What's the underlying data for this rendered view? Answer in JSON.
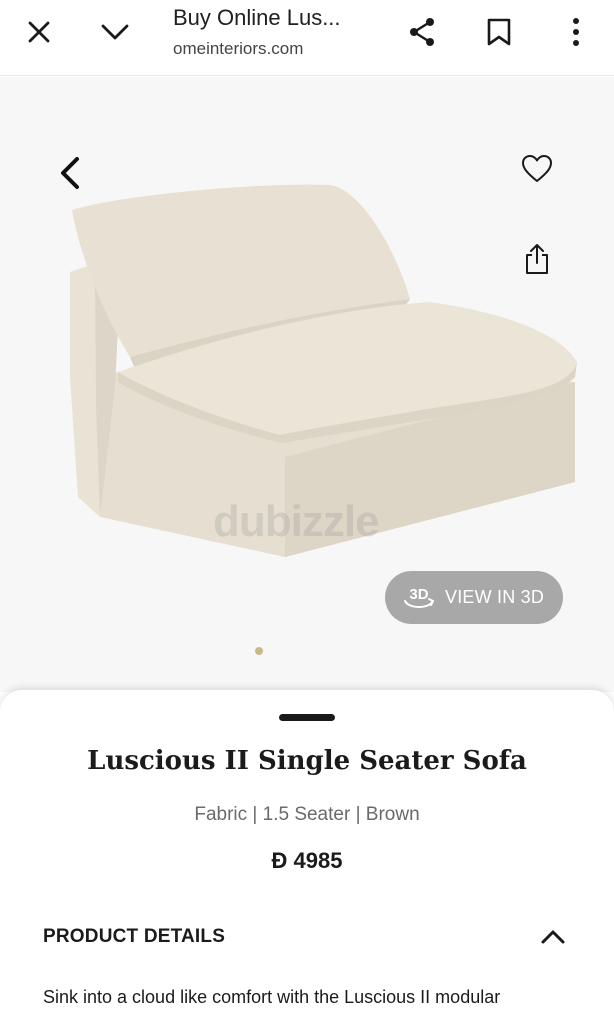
{
  "browser": {
    "title": "Buy Online Lus...",
    "url": "omeinteriors.com",
    "icons": {
      "close": "close-icon",
      "dropdown": "chevron-down-icon",
      "share": "share-icon",
      "bookmark": "bookmark-icon",
      "more": "more-vert-icon"
    }
  },
  "gallery": {
    "watermark": "dubizzle",
    "view3d_badge": "3D",
    "view3d_label": "VIEW IN 3D",
    "icons": {
      "back": "chevron-left-icon",
      "favorite": "heart-icon",
      "upload": "upload-icon"
    }
  },
  "product": {
    "title": "Luscious II Single Seater Sofa",
    "subtitle": "Fabric | 1.5 Seater | Brown",
    "currency": "Đ",
    "price": "4985",
    "details_header": "PRODUCT DETAILS",
    "description_preview": "Sink into a cloud like comfort with the Luscious II modular"
  },
  "colors": {
    "view3d_bg": "#a8a8a8",
    "dot_active": "#c9b98a",
    "sofa_fabric": "#e7e0d3"
  }
}
